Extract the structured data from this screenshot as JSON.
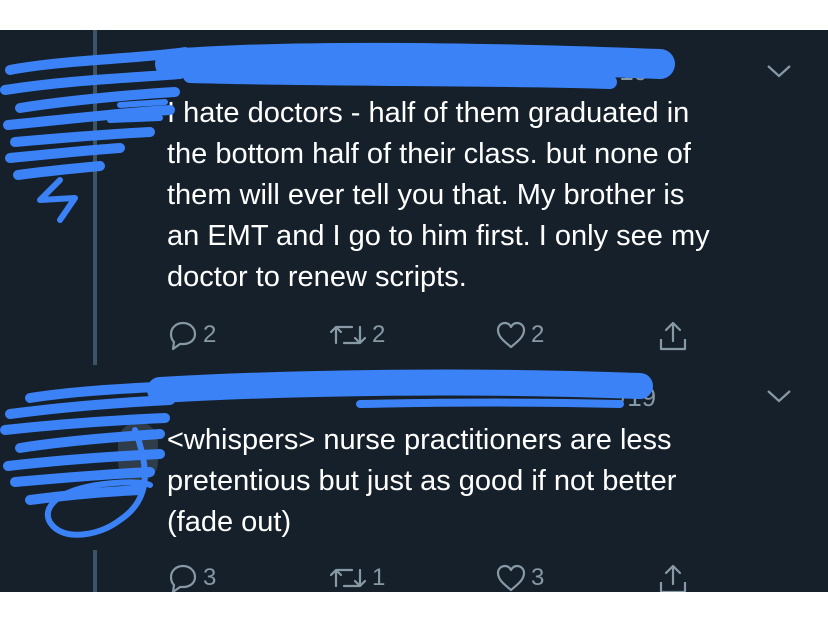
{
  "tweets": [
    {
      "date_fragment": "/19",
      "text_lines": [
        "I hate doctors - half of them graduated in",
        "the bottom half of their class.  but none of",
        "them will ever tell you that.  My brother is",
        "an EMT and I go to him first.  I only see my",
        "doctor to renew scripts."
      ],
      "replies": "2",
      "retweets": "2",
      "likes": "2"
    },
    {
      "date_fragment": "/19",
      "text_lines": [
        "<whispers> nurse practitioners are less",
        "pretentious but just as good if not better",
        "(fade out)"
      ],
      "replies": "3",
      "retweets": "1",
      "likes": "3"
    }
  ],
  "icons": {
    "reply": "reply-icon",
    "retweet": "retweet-icon",
    "like": "heart-icon",
    "share": "share-icon",
    "menu": "chevron-down-icon"
  },
  "colors": {
    "background": "#15202b",
    "text": "#ffffff",
    "secondary_text": "#8899a6",
    "thread_line": "#3d5466",
    "redaction": "#3b82f6"
  }
}
